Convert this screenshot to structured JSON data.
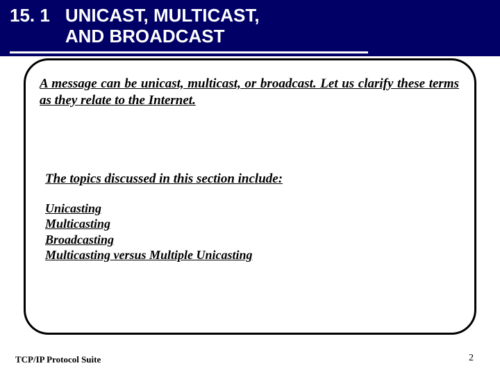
{
  "header": {
    "section_number": "15. 1",
    "title_line1": "UNICAST, MULTICAST,",
    "title_line2": "AND BROADCAST"
  },
  "intro": "A message can be unicast, multicast, or broadcast. Let us clarify these terms as they relate to the Internet.",
  "topic_lead": "The topics discussed in this section include:",
  "topics": [
    "Unicasting",
    "Multicasting",
    "Broadcasting",
    "Multicasting versus Multiple Unicasting"
  ],
  "footer": {
    "left": "TCP/IP Protocol Suite",
    "page": "2"
  }
}
